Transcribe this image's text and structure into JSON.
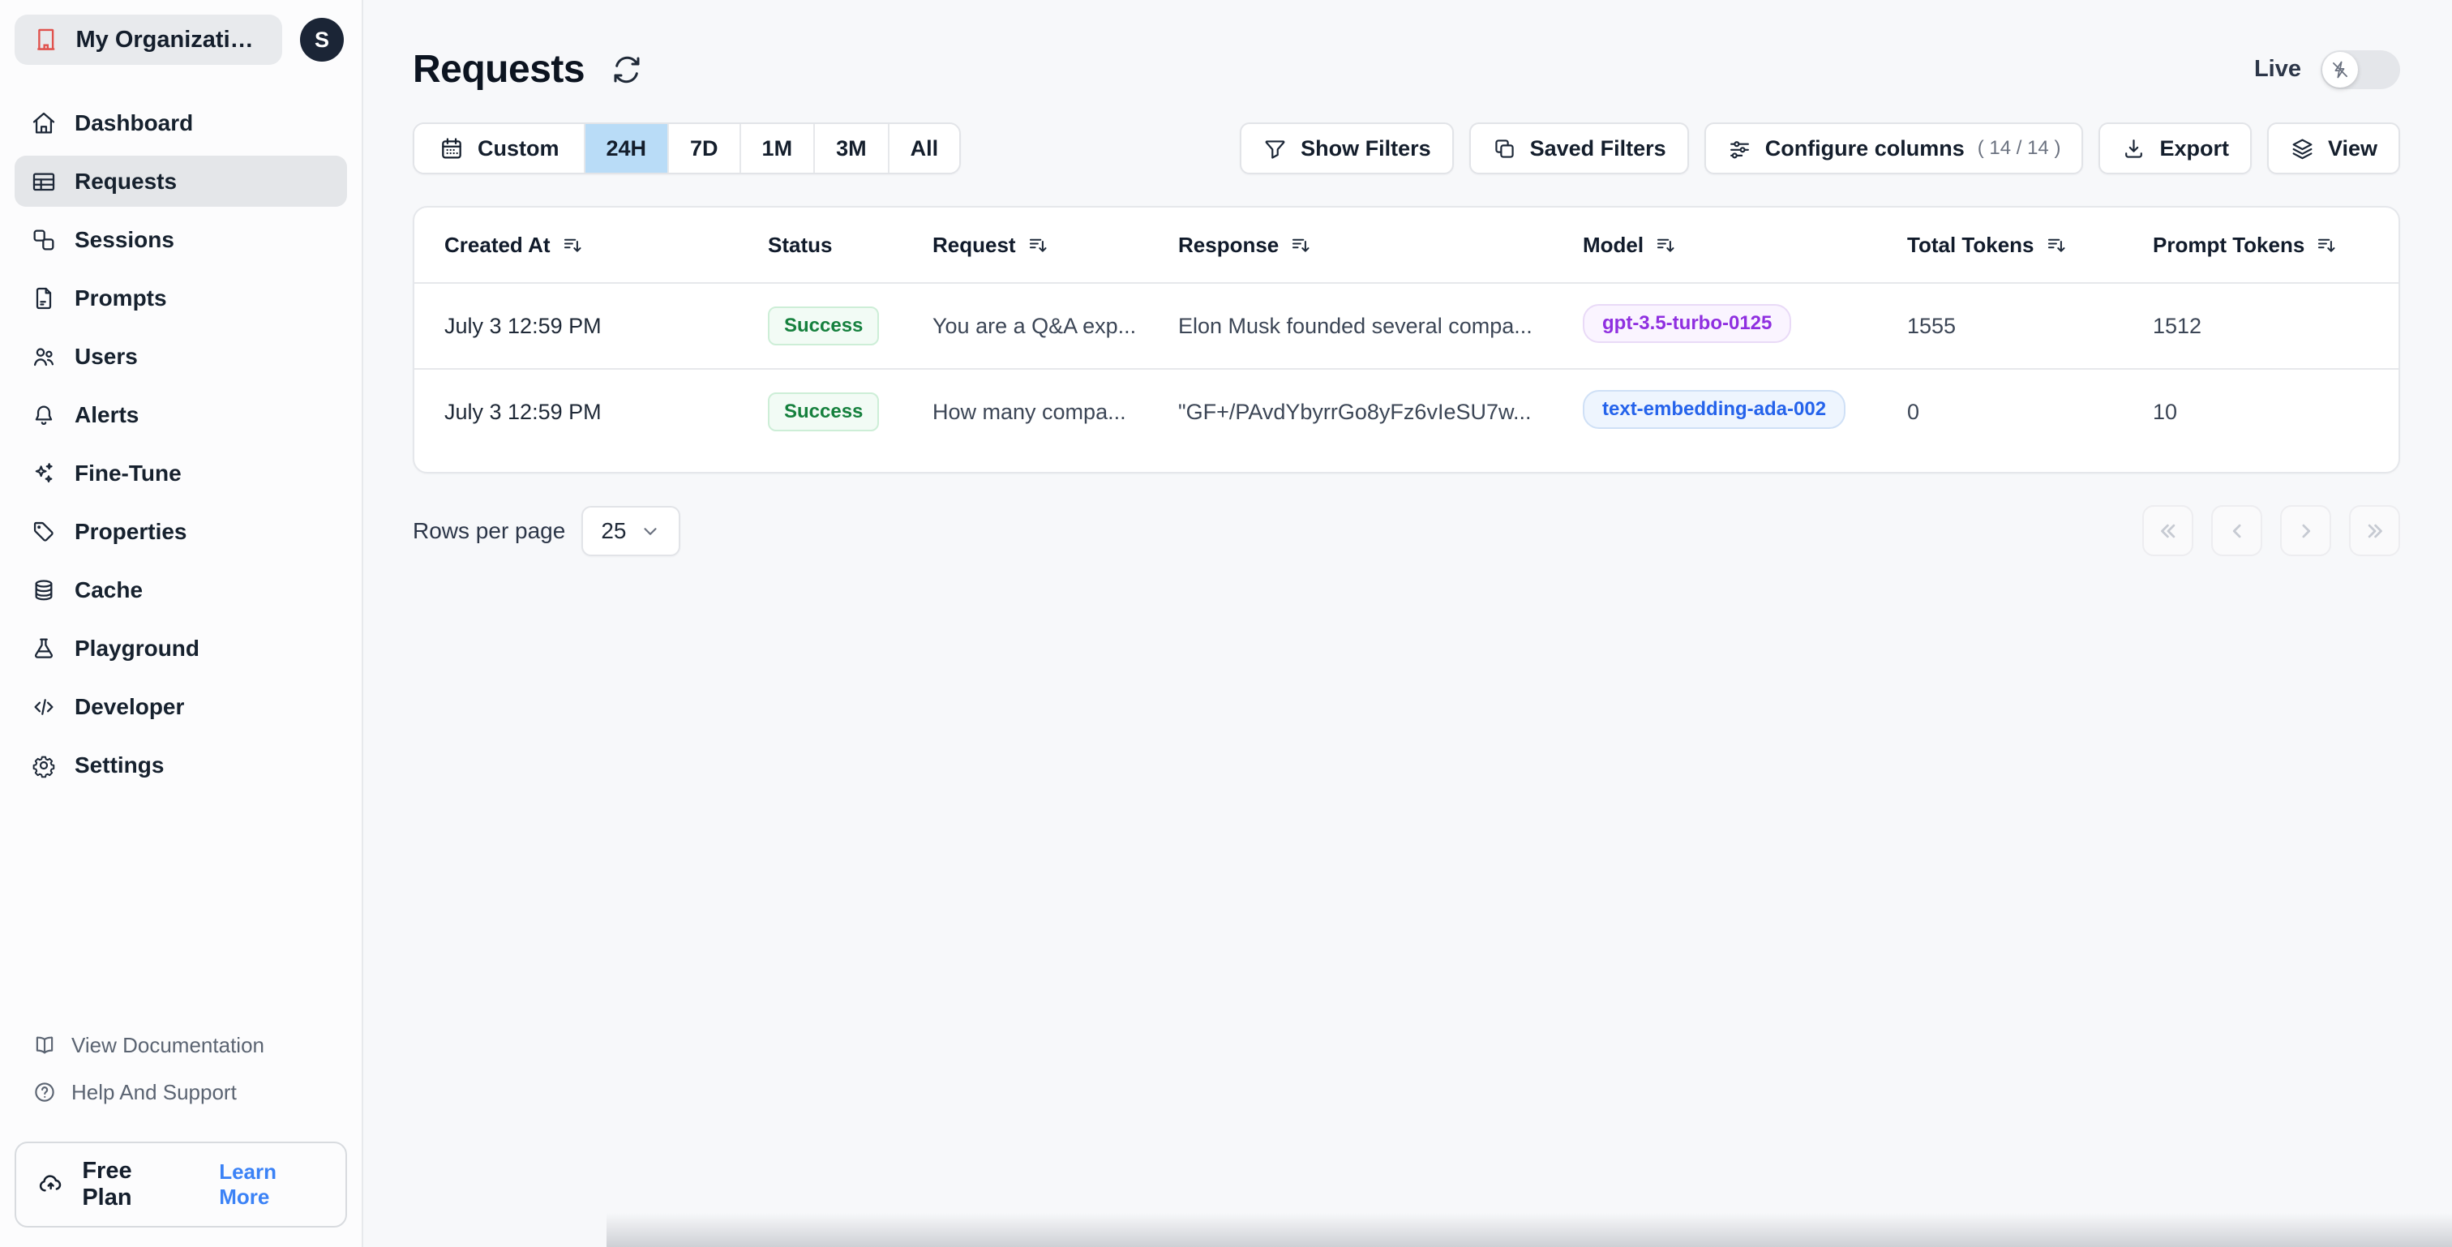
{
  "org": {
    "name": "My Organizatio...",
    "avatar_initial": "S"
  },
  "sidebar": {
    "items": [
      {
        "label": "Dashboard"
      },
      {
        "label": "Requests"
      },
      {
        "label": "Sessions"
      },
      {
        "label": "Prompts"
      },
      {
        "label": "Users"
      },
      {
        "label": "Alerts"
      },
      {
        "label": "Fine-Tune"
      },
      {
        "label": "Properties"
      },
      {
        "label": "Cache"
      },
      {
        "label": "Playground"
      },
      {
        "label": "Developer"
      },
      {
        "label": "Settings"
      }
    ],
    "active_item": "Requests",
    "footer_links": [
      {
        "label": "View Documentation"
      },
      {
        "label": "Help And Support"
      }
    ],
    "plan": {
      "label": "Free Plan",
      "cta": "Learn More"
    }
  },
  "header": {
    "title": "Requests",
    "live_label": "Live",
    "live_on": false
  },
  "toolbar": {
    "time_ranges": [
      "Custom",
      "24H",
      "7D",
      "1M",
      "3M",
      "All"
    ],
    "selected_range": "24H",
    "show_filters": "Show Filters",
    "saved_filters": "Saved Filters",
    "configure_columns": "Configure columns",
    "configure_columns_count": "( 14 / 14 )",
    "export": "Export",
    "view": "View"
  },
  "table": {
    "columns": [
      {
        "label": "Created At",
        "sortable": true
      },
      {
        "label": "Status",
        "sortable": false
      },
      {
        "label": "Request",
        "sortable": true
      },
      {
        "label": "Response",
        "sortable": true
      },
      {
        "label": "Model",
        "sortable": true
      },
      {
        "label": "Total Tokens",
        "sortable": true
      },
      {
        "label": "Prompt Tokens",
        "sortable": true
      }
    ],
    "rows": [
      {
        "created_at": "July 3 12:59 PM",
        "status": "Success",
        "request": "You are a Q&A exp...",
        "response": "Elon Musk founded several compa...",
        "model": "gpt-3.5-turbo-0125",
        "model_badge_class": "badge-model purple",
        "total_tokens": "1555",
        "prompt_tokens": "1512"
      },
      {
        "created_at": "July 3 12:59 PM",
        "status": "Success",
        "request": "How many compa...",
        "response": "\"GF+/PAvdYbyrrGo8yFz6vIeSU7w...",
        "model": "text-embedding-ada-002",
        "model_badge_class": "badge-model blue",
        "total_tokens": "0",
        "prompt_tokens": "10"
      }
    ]
  },
  "pagination": {
    "rows_per_page_label": "Rows per page",
    "rows_per_page_value": "25"
  },
  "colors": {
    "accent_blue_selected": "#b9dcf7",
    "success_green": "#15803d",
    "model_purple": "#8f2fe0",
    "model_blue": "#2563eb",
    "brand_red": "#e0524d",
    "link_blue": "#3b82f6"
  }
}
